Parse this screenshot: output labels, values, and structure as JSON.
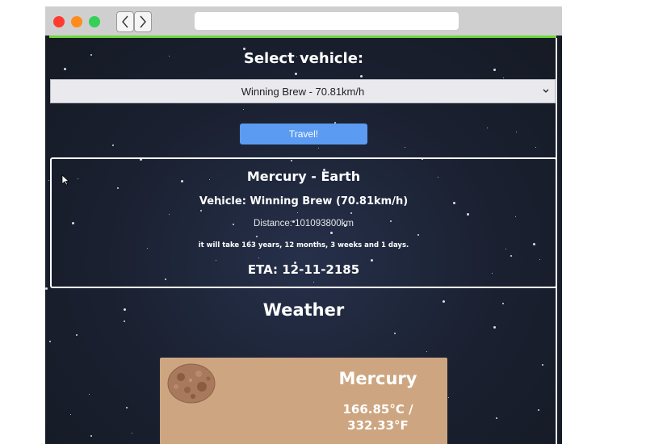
{
  "select_section": {
    "heading": "Select vehicle:",
    "selected_vehicle": "Winning Brew - 70.81km/h",
    "travel_button": "Travel!"
  },
  "trip": {
    "route": "Mercury - Earth",
    "vehicle": "Vehicle: Winning Brew (70.81km/h)",
    "distance": "Distance: 101093800km",
    "duration": "it will take 163 years, 12 months, 3 weeks and 1 days.",
    "eta": "ETA: 12-11-2185"
  },
  "weather": {
    "heading": "Weather",
    "planet": {
      "name": "Mercury",
      "temp_c": "166.85°C /",
      "temp_f": "332.33°F"
    }
  },
  "colors": {
    "progress_bar": "#6cd93a",
    "travel_button": "#5b9bf2",
    "planet_card": "#cda681",
    "background": "#1b1f2a"
  }
}
